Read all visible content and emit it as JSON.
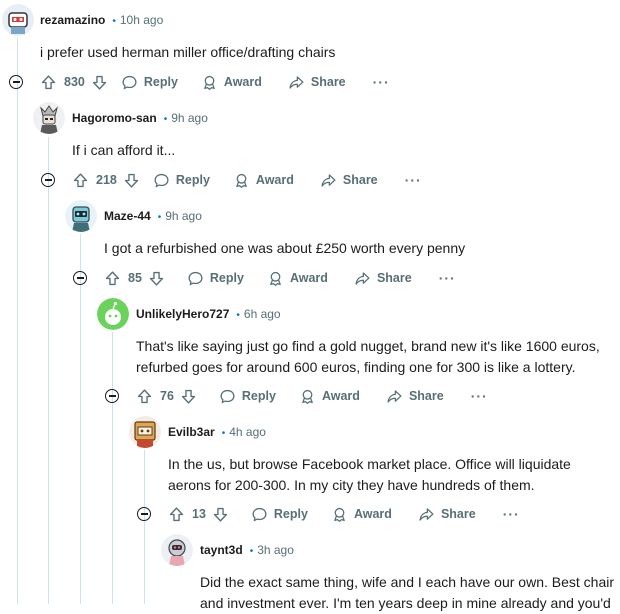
{
  "comments": [
    {
      "author": "rezamazino",
      "time": "10h ago",
      "lines": [
        "i prefer used herman miller office/drafting chairs"
      ],
      "score": "830",
      "reply": "Reply",
      "award": "Award",
      "share": "Share",
      "more": "···"
    },
    {
      "author": "Hagoromo-san",
      "time": "9h ago",
      "lines": [
        "If i can afford it..."
      ],
      "score": "218",
      "reply": "Reply",
      "award": "Award",
      "share": "Share",
      "more": "···"
    },
    {
      "author": "Maze-44",
      "time": "9h ago",
      "lines": [
        "I got a refurbished one was about £250 worth every penny"
      ],
      "score": "85",
      "reply": "Reply",
      "award": "Award",
      "share": "Share",
      "more": "···"
    },
    {
      "author": "UnlikelyHero727",
      "time": "6h ago",
      "lines": [
        "That's like saying just go find a gold nugget, brand new it's like 1600 euros,",
        "refurbed goes for around 600 euros, finding one for 300 is like a lottery."
      ],
      "score": "76",
      "reply": "Reply",
      "award": "Award",
      "share": "Share",
      "more": "···"
    },
    {
      "author": "Evilb3ar",
      "time": "4h ago",
      "lines": [
        "In the us, but browse Facebook market place. Office will liquidate",
        "aerons for 200-300. In my city they have hundreds of them."
      ],
      "score": "13",
      "reply": "Reply",
      "award": "Award",
      "share": "Share",
      "more": "···"
    },
    {
      "author": "taynt3d",
      "time": "3h ago",
      "lines": [
        "Did the exact same thing, wife and I each have our own. Best chair",
        "and investment ever. I'm ten years deep in mine already and you'd"
      ]
    }
  ],
  "colors": {
    "dot": "#0079d3",
    "thread": "#cfe0ef",
    "meta": "#576f76"
  }
}
